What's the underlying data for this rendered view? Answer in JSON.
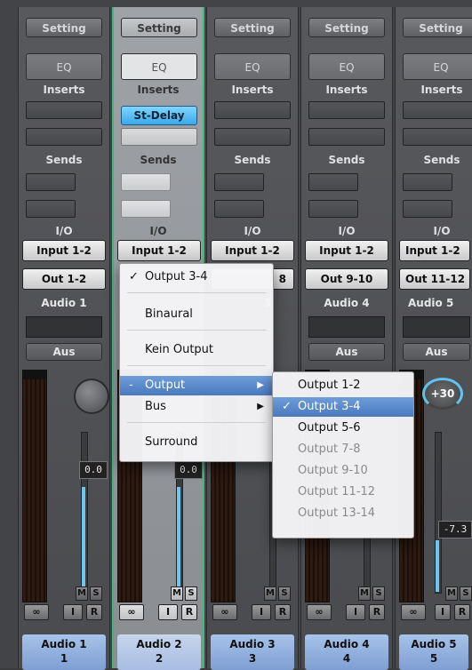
{
  "strips": [
    {
      "setting": "Setting",
      "eq": "EQ",
      "inserts": "Inserts",
      "sends": "Sends",
      "io": "I/O",
      "input": "Input 1-2",
      "output": "Out 1-2",
      "name": "Audio 1",
      "aus": "Aus",
      "value": "0.0",
      "m": "M",
      "s": "S",
      "link": "∞",
      "i": "I",
      "r": "R",
      "footer_name": "Audio 1",
      "footer_num": "1"
    },
    {
      "setting": "Setting",
      "eq": "EQ",
      "inserts": "Inserts",
      "plugin": "St-Delay",
      "sends": "Sends",
      "io": "I/O",
      "input": "Input 1-2",
      "value": "0.0",
      "m": "M",
      "s": "S",
      "link": "∞",
      "i": "I",
      "r": "R",
      "footer_name": "Audio 2",
      "footer_num": "2"
    },
    {
      "setting": "Setting",
      "eq": "EQ",
      "inserts": "Inserts",
      "sends": "Sends",
      "io": "I/O",
      "input": "Input 1-2",
      "output": "8",
      "name": "3",
      "m": "M",
      "s": "S",
      "link": "∞",
      "i": "I",
      "r": "R",
      "footer_name": "Audio 3",
      "footer_num": "3"
    },
    {
      "setting": "Setting",
      "eq": "EQ",
      "inserts": "Inserts",
      "sends": "Sends",
      "io": "I/O",
      "input": "Input 1-2",
      "output": "Out 9-10",
      "name": "Audio 4",
      "aus": "Aus",
      "m": "M",
      "s": "S",
      "link": "∞",
      "i": "I",
      "r": "R",
      "footer_name": "Audio 4",
      "footer_num": "4"
    },
    {
      "setting": "Setting",
      "eq": "EQ",
      "inserts": "Inserts",
      "sends": "Sends",
      "io": "I/O",
      "input": "Input 1-2",
      "output": "Out 11-12",
      "name": "Audio 5",
      "aus": "Aus",
      "knob": "+30",
      "value": "-7.3",
      "m": "M",
      "s": "S",
      "link": "∞",
      "i": "I",
      "r": "R",
      "footer_name": "Audio 5",
      "footer_num": "5"
    }
  ],
  "popup": {
    "items": [
      "Output 3-4",
      "Binaural",
      "Kein Output",
      "Output",
      "Bus",
      "Surround"
    ],
    "checked": "✓",
    "dash": "-",
    "arrow": "▶"
  },
  "submenu": {
    "items": [
      "Output 1-2",
      "Output 3-4",
      "Output 5-6",
      "Output 7-8",
      "Output 9-10",
      "Output 11-12",
      "Output 13-14"
    ],
    "checked": "✓"
  },
  "colors": {
    "selection_border": "#3fb87b",
    "highlight": "#4a79bf",
    "plugin": "#3aa8e8",
    "meter_fill": "#6cc6ee"
  }
}
